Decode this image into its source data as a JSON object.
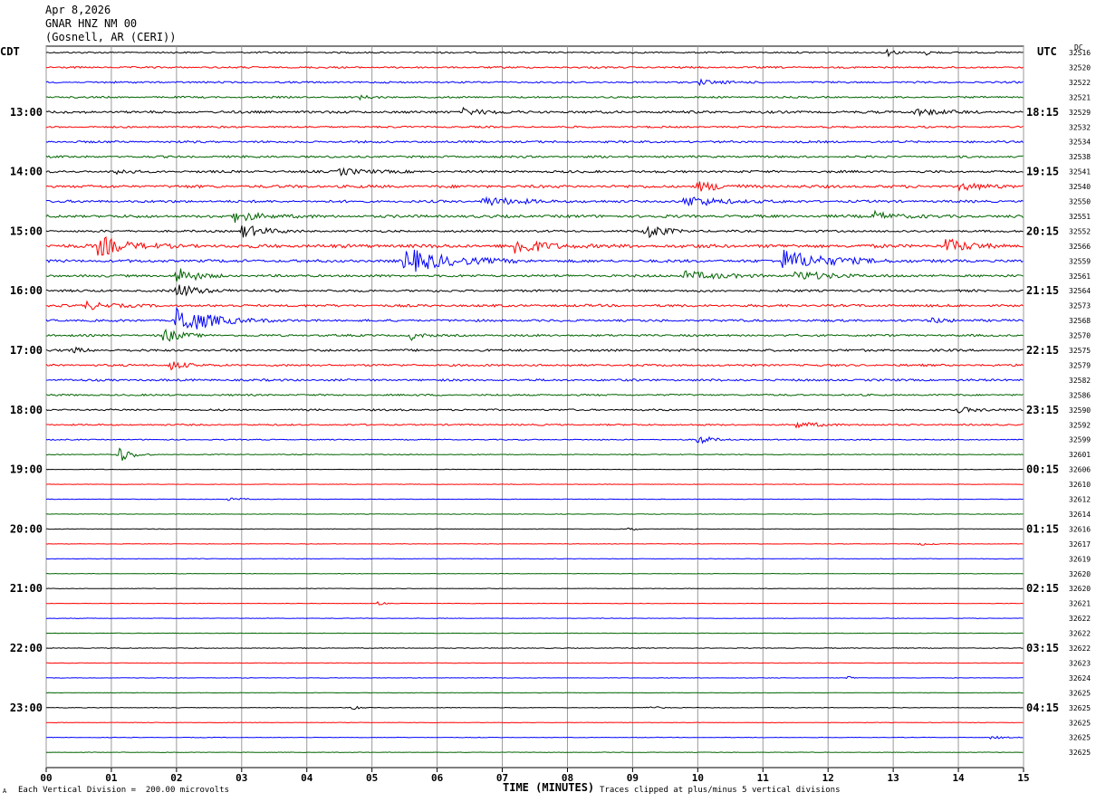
{
  "header": {
    "date": "Apr 8,2026",
    "station": "GNAR HNZ NM 00",
    "location": "(Gosnell, AR (CERI))"
  },
  "left_tz": "CDT",
  "right_tz": "UTC",
  "dc_label": "DC",
  "footer": {
    "scale_note": "Each Vertical Division =  200.00 microvolts",
    "clip_note": "Traces clipped at plus/minus 5 vertical divisions",
    "corner_mark": "A"
  },
  "colors": {
    "black": "#000000",
    "red": "#ff0000",
    "blue": "#0000ff",
    "green": "#006400",
    "grid": "#9a9a9a"
  },
  "chart_data": {
    "type": "line",
    "title": "GNAR HNZ NM 00",
    "xlabel": "TIME (MINUTES)",
    "xlim": [
      0,
      15
    ],
    "x_ticks": [
      "00",
      "01",
      "02",
      "03",
      "04",
      "05",
      "06",
      "07",
      "08",
      "09",
      "10",
      "11",
      "12",
      "13",
      "14",
      "15"
    ],
    "trace_minutes": 15,
    "trace_color_cycle": [
      "black",
      "red",
      "blue",
      "green"
    ],
    "left_hour_labels": [
      "13:00",
      "14:00",
      "15:00",
      "16:00",
      "17:00",
      "18:00",
      "19:00",
      "20:00",
      "21:00",
      "22:00",
      "23:00"
    ],
    "right_hour_labels": [
      "18:15",
      "19:15",
      "20:15",
      "21:15",
      "22:15",
      "23:15",
      "00:15",
      "01:15",
      "02:15",
      "03:15",
      "04:15"
    ],
    "dc_offsets": [
      32516,
      32520,
      32522,
      32521,
      32529,
      32532,
      32534,
      32538,
      32541,
      32540,
      32550,
      32551,
      32552,
      32566,
      32559,
      32561,
      32564,
      32573,
      32568,
      32570,
      32575,
      32579,
      32582,
      32586,
      32590,
      32592,
      32599,
      32601,
      32606,
      32610,
      32612,
      32614,
      32616,
      32617,
      32619,
      32620,
      32620,
      32621,
      32622,
      32622,
      32622,
      32623,
      32624,
      32625,
      32625,
      32625,
      32625,
      32625
    ],
    "trace_noise": [
      0.9,
      1.0,
      1.0,
      1.0,
      1.4,
      1.0,
      1.2,
      1.2,
      1.3,
      1.6,
      1.4,
      1.6,
      1.2,
      2.0,
      1.6,
      1.4,
      1.3,
      1.4,
      1.3,
      1.2,
      1.3,
      1.2,
      1.2,
      1.0,
      1.0,
      0.9,
      0.6,
      0.5,
      0.3,
      0.3,
      0.3,
      0.3,
      0.3,
      0.3,
      0.35,
      0.3,
      0.3,
      0.3,
      0.3,
      0.3,
      0.4,
      0.3,
      0.3,
      0.3,
      0.35,
      0.3,
      0.3,
      0.3
    ],
    "events": [
      {
        "trace": 0,
        "minute": 12.9,
        "amp": 4,
        "dur": 0.2
      },
      {
        "trace": 0,
        "minute": 13.5,
        "amp": 3,
        "dur": 0.2
      },
      {
        "trace": 2,
        "minute": 10.0,
        "amp": 3,
        "dur": 0.5
      },
      {
        "trace": 3,
        "minute": 4.8,
        "amp": 2,
        "dur": 0.3
      },
      {
        "trace": 4,
        "minute": 6.4,
        "amp": 4,
        "dur": 0.5
      },
      {
        "trace": 4,
        "minute": 13.3,
        "amp": 4,
        "dur": 0.6
      },
      {
        "trace": 8,
        "minute": 4.5,
        "amp": 4,
        "dur": 0.6
      },
      {
        "trace": 8,
        "minute": 1.1,
        "amp": 4,
        "dur": 0.2
      },
      {
        "trace": 9,
        "minute": 10.0,
        "amp": 5,
        "dur": 0.6
      },
      {
        "trace": 9,
        "minute": 14.0,
        "amp": 4,
        "dur": 0.6
      },
      {
        "trace": 10,
        "minute": 6.7,
        "amp": 5,
        "dur": 0.8
      },
      {
        "trace": 10,
        "minute": 9.8,
        "amp": 6,
        "dur": 0.8
      },
      {
        "trace": 11,
        "minute": 2.9,
        "amp": 6,
        "dur": 0.6
      },
      {
        "trace": 11,
        "minute": 12.7,
        "amp": 5,
        "dur": 0.5
      },
      {
        "trace": 12,
        "minute": 3.0,
        "amp": 8,
        "dur": 0.5
      },
      {
        "trace": 12,
        "minute": 9.2,
        "amp": 10,
        "dur": 0.4
      },
      {
        "trace": 13,
        "minute": 0.8,
        "amp": 12,
        "dur": 0.6
      },
      {
        "trace": 13,
        "minute": 7.2,
        "amp": 10,
        "dur": 0.6
      },
      {
        "trace": 13,
        "minute": 13.8,
        "amp": 8,
        "dur": 0.5
      },
      {
        "trace": 14,
        "minute": 5.5,
        "amp": 14,
        "dur": 1.0
      },
      {
        "trace": 14,
        "minute": 11.3,
        "amp": 12,
        "dur": 1.0
      },
      {
        "trace": 15,
        "minute": 9.8,
        "amp": 5,
        "dur": 0.8
      },
      {
        "trace": 15,
        "minute": 11.5,
        "amp": 5,
        "dur": 0.8
      },
      {
        "trace": 15,
        "minute": 2.0,
        "amp": 10,
        "dur": 0.4
      },
      {
        "trace": 16,
        "minute": 2.0,
        "amp": 8,
        "dur": 0.5
      },
      {
        "trace": 17,
        "minute": 0.6,
        "amp": 5,
        "dur": 0.5
      },
      {
        "trace": 18,
        "minute": 2.0,
        "amp": 16,
        "dur": 0.8
      },
      {
        "trace": 18,
        "minute": 13.6,
        "amp": 3,
        "dur": 0.4
      },
      {
        "trace": 19,
        "minute": 1.8,
        "amp": 8,
        "dur": 0.4
      },
      {
        "trace": 19,
        "minute": 5.6,
        "amp": 5,
        "dur": 0.2
      },
      {
        "trace": 20,
        "minute": 0.4,
        "amp": 3,
        "dur": 0.3
      },
      {
        "trace": 21,
        "minute": 1.9,
        "amp": 6,
        "dur": 0.3
      },
      {
        "trace": 24,
        "minute": 14.0,
        "amp": 3,
        "dur": 0.5
      },
      {
        "trace": 25,
        "minute": 11.5,
        "amp": 3,
        "dur": 0.6
      },
      {
        "trace": 26,
        "minute": 10.0,
        "amp": 6,
        "dur": 0.3
      },
      {
        "trace": 27,
        "minute": 1.1,
        "amp": 10,
        "dur": 0.3
      },
      {
        "trace": 30,
        "minute": 2.8,
        "amp": 1.5,
        "dur": 0.4
      },
      {
        "trace": 32,
        "minute": 8.95,
        "amp": 5,
        "dur": 0.1
      },
      {
        "trace": 33,
        "minute": 13.4,
        "amp": 1.5,
        "dur": 0.3
      },
      {
        "trace": 37,
        "minute": 5.1,
        "amp": 3,
        "dur": 0.1
      },
      {
        "trace": 42,
        "minute": 12.3,
        "amp": 3,
        "dur": 0.1
      },
      {
        "trace": 44,
        "minute": 4.7,
        "amp": 4,
        "dur": 0.15
      },
      {
        "trace": 44,
        "minute": 9.2,
        "amp": 2,
        "dur": 0.3
      },
      {
        "trace": 46,
        "minute": 14.5,
        "amp": 2,
        "dur": 0.3
      }
    ]
  }
}
